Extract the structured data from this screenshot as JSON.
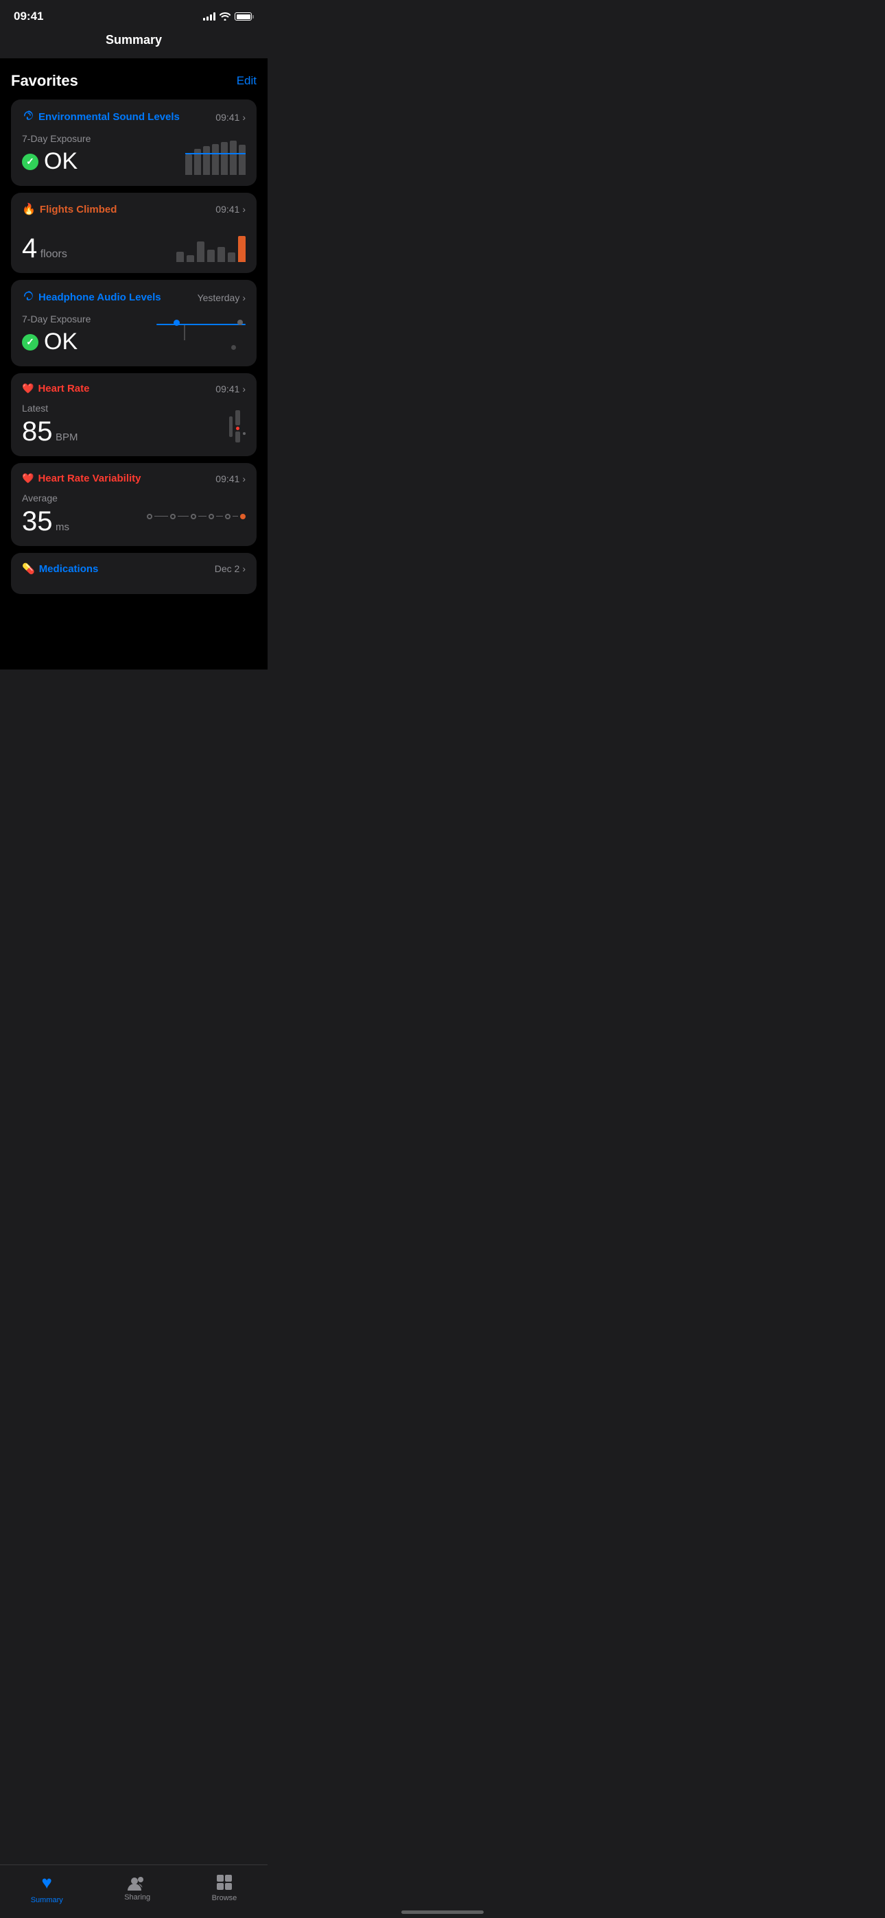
{
  "statusBar": {
    "time": "09:41"
  },
  "header": {
    "title": "Summary"
  },
  "favorites": {
    "sectionTitle": "Favorites",
    "editLabel": "Edit",
    "cards": [
      {
        "id": "environmental-sound",
        "title": "Environmental Sound Levels",
        "titleColor": "blue",
        "iconType": "hearing",
        "time": "09:41",
        "label": "7-Day Exposure",
        "status": "OK",
        "hasCheck": true,
        "chartType": "env-bars"
      },
      {
        "id": "flights-climbed",
        "title": "Flights Climbed",
        "titleColor": "orange",
        "iconType": "flame",
        "time": "09:41",
        "label": "",
        "value": "4",
        "unit": "floors",
        "chartType": "flights-bars"
      },
      {
        "id": "headphone-audio",
        "title": "Headphone Audio Levels",
        "titleColor": "blue",
        "iconType": "hearing",
        "time": "Yesterday",
        "label": "7-Day Exposure",
        "status": "OK",
        "hasCheck": true,
        "chartType": "headphone"
      },
      {
        "id": "heart-rate",
        "title": "Heart Rate",
        "titleColor": "red",
        "iconType": "heart",
        "time": "09:41",
        "label": "Latest",
        "value": "85",
        "unit": "BPM",
        "chartType": "heart-rate"
      },
      {
        "id": "heart-rate-variability",
        "title": "Heart Rate Variability",
        "titleColor": "red",
        "iconType": "heart",
        "time": "09:41",
        "label": "Average",
        "value": "35",
        "unit": "ms",
        "chartType": "hrv"
      },
      {
        "id": "medications",
        "title": "Medications",
        "titleColor": "blue",
        "iconType": "meds",
        "time": "Dec 2",
        "label": "",
        "value": "",
        "unit": "",
        "chartType": "none"
      }
    ]
  },
  "bottomNav": {
    "items": [
      {
        "id": "summary",
        "label": "Summary",
        "active": true
      },
      {
        "id": "sharing",
        "label": "Sharing",
        "active": false
      },
      {
        "id": "browse",
        "label": "Browse",
        "active": false
      }
    ]
  }
}
